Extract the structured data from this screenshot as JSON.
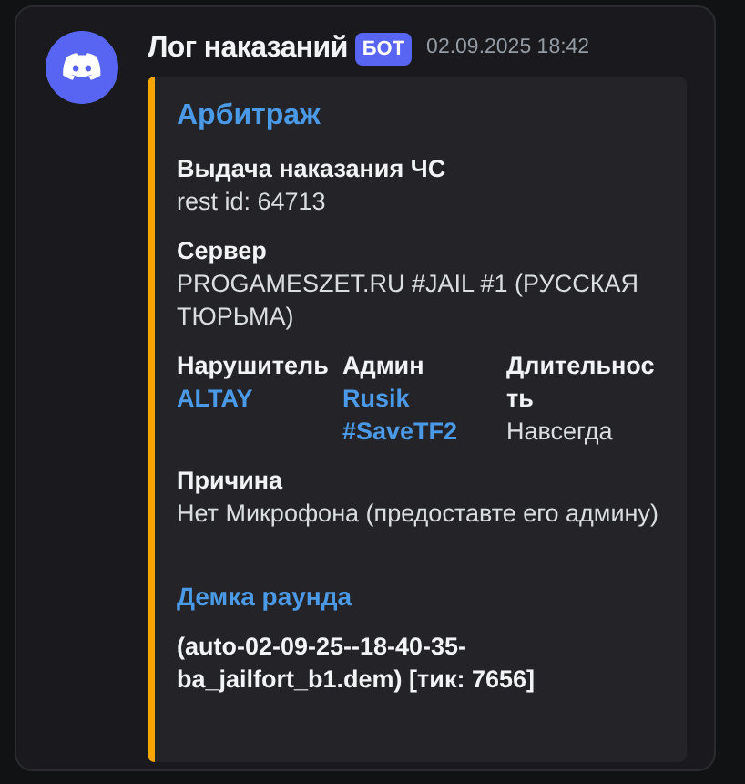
{
  "message": {
    "author": "Лог наказаний",
    "badge": "БОТ",
    "timestamp": "02.09.2025 18:42"
  },
  "embed": {
    "title": "Арбитраж",
    "fields": [
      {
        "name": "Выдача наказания ЧС",
        "inline": false,
        "values": [
          {
            "kind": "text",
            "text": "rest id: 64713"
          }
        ]
      },
      {
        "name": "Сервер",
        "inline": false,
        "values": [
          {
            "kind": "text",
            "text": "PROGAMESZET.RU #JAIL #1 (РУССКАЯ ТЮРЬМА)"
          }
        ]
      },
      {
        "name": "Нарушитель",
        "inline": true,
        "values": [
          {
            "kind": "link",
            "text": "ALTAY"
          }
        ]
      },
      {
        "name": "Админ",
        "inline": true,
        "values": [
          {
            "kind": "link",
            "text": "Rusik #SaveTF2"
          }
        ]
      },
      {
        "name": "Длительность",
        "inline": true,
        "values": [
          {
            "kind": "text",
            "text": "Навсегда"
          }
        ]
      },
      {
        "name": "Причина",
        "inline": false,
        "values": [
          {
            "kind": "text",
            "text": "Нет Микрофона (предоставте его админу)"
          }
        ]
      }
    ],
    "demo": {
      "title": "Демка раунда",
      "value": "(auto-02-09-25--18-40-35-ba_jailfort_b1.dem) [тик: 7656]"
    }
  }
}
